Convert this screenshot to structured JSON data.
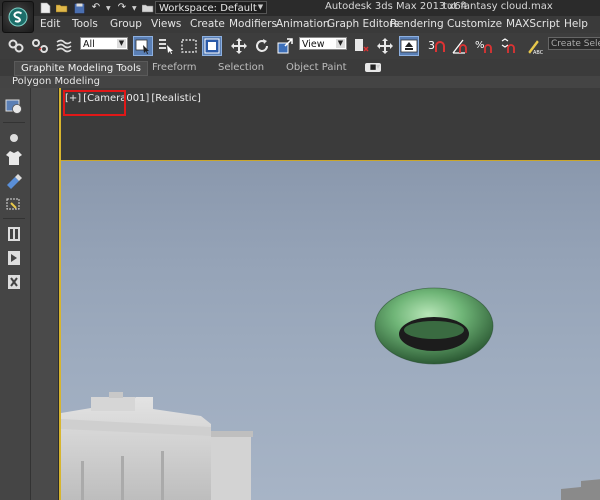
{
  "titlebar": {
    "workspace_label": "Workspace: Default",
    "app_title": "Autodesk 3ds Max  2013 x64",
    "file_name": "tut fantasy cloud.max"
  },
  "menubar": {
    "items": [
      "Edit",
      "Tools",
      "Group",
      "Views",
      "Create",
      "Modifiers",
      "Animation",
      "Graph Editors",
      "Rendering",
      "Customize",
      "MAXScript",
      "Help"
    ]
  },
  "toolbar": {
    "selection_filter": "All",
    "ref_coord": "View",
    "search_placeholder": "Create Selection Se",
    "snap_3_label": "3"
  },
  "ribbon": {
    "tabs": [
      "Graphite Modeling Tools",
      "Freeform",
      "Selection",
      "Object Paint"
    ],
    "active_tab": "Graphite Modeling Tools",
    "sub_label": "Polygon Modeling"
  },
  "viewport": {
    "label_plus": "[+]",
    "label_camera": "[Camera001]",
    "label_shading": "[Realistic]"
  },
  "colors": {
    "selection_highlight": "#e01818",
    "active_viewport_border": "#d7b52e",
    "torus": "#6fb577"
  }
}
